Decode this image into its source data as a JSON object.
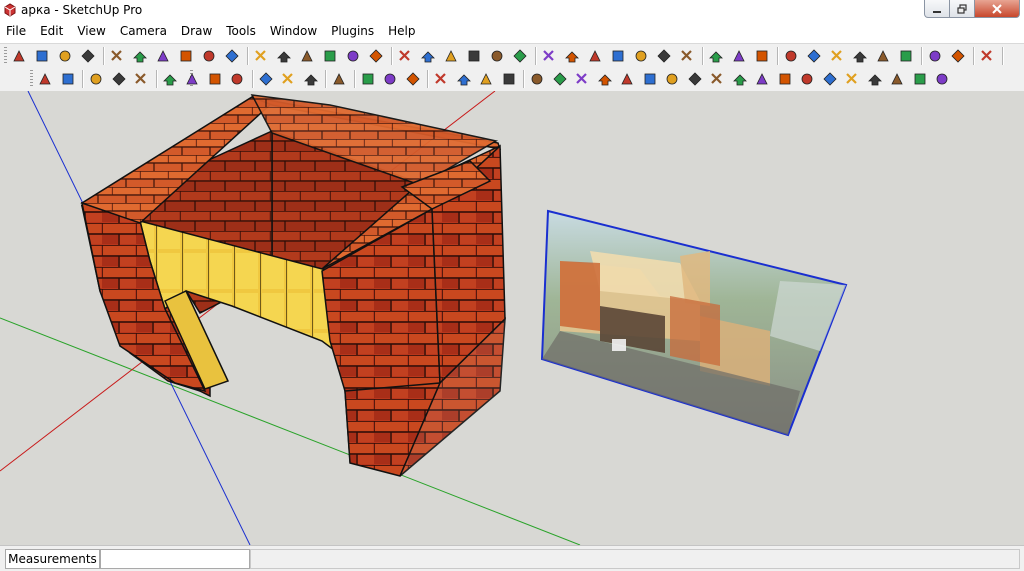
{
  "window": {
    "title": "арка - SketchUp Pro"
  },
  "menu": [
    "File",
    "Edit",
    "View",
    "Camera",
    "Draw",
    "Tools",
    "Window",
    "Plugins",
    "Help"
  ],
  "toolbar1": [
    "select-icon",
    "make-component-icon",
    "paint-bucket-icon",
    "eraser-icon",
    "rectangle-icon",
    "line-icon",
    "circle-icon",
    "arc-icon",
    "polygon-icon",
    "freehand-icon",
    "move-icon",
    "push-pull-icon",
    "rotate-icon",
    "follow-me-icon",
    "scale-icon",
    "offset-icon",
    "tape-measure-icon",
    "dimension-icon",
    "protractor-icon",
    "text-icon",
    "axes-icon",
    "3d-text-icon",
    "orbit-icon",
    "pan-icon",
    "zoom-icon",
    "zoom-window-icon",
    "previous-view-icon",
    "next-view-icon",
    "zoom-extents-icon",
    "position-camera-icon",
    "walk-icon",
    "look-around-icon",
    "section-plane-icon",
    "iso-view-icon",
    "front-view-icon",
    "top-view-icon",
    "right-view-icon",
    "back-view-icon",
    "left-view-icon",
    "undo-icon",
    "print-icon",
    "sandbox-icon"
  ],
  "toolbar2": [
    "add-location-icon",
    "show-terrain-icon",
    "xray-icon",
    "back-edges-icon",
    "wireframe-icon",
    "hidden-line-icon",
    "shaded-icon",
    "textured-icon",
    "monochrome-icon",
    "flip-red-icon",
    "flip-green-icon",
    "flip-blue-icon",
    "intersect-icon",
    "outer-shell-icon",
    "union-icon",
    "subtract-icon",
    "trim-icon",
    "split-icon",
    "solid-tools-icon",
    "smoove-icon",
    "stamp-icon",
    "drape-icon",
    "add-detail-icon",
    "flip-edge-icon",
    "from-contours-icon",
    "from-scratch-icon",
    "roundcorner-icon",
    "fillet-icon",
    "chamfer-icon",
    "extrude-icon",
    "loft-icon",
    "sweep-icon",
    "bezier-icon",
    "polyline-icon",
    "spline-icon",
    "convert-icon",
    "subdivide-icon",
    "smooth-icon",
    "crease-icon"
  ],
  "status": {
    "measurements_label": "Measurements",
    "measurements_value": ""
  }
}
